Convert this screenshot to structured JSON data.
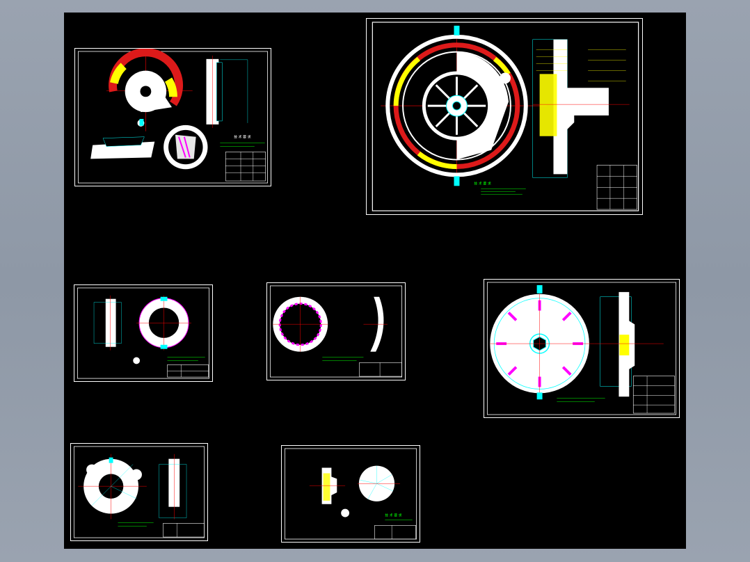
{
  "viewer": {
    "background_color": "#9aa3b0",
    "canvas_color": "#000000",
    "line_colors": {
      "outline": "#ffffff",
      "center": "#ff0000",
      "dimension": "#00ffff",
      "hatch_red": "#dd1a1a",
      "hatch_yellow": "#ffff00",
      "spring": "#ff66ff",
      "note": "#00ff00"
    }
  },
  "sheets": [
    {
      "id": "sheet-1",
      "content": "clutch assembly sectional view with spring and lever details"
    },
    {
      "id": "sheet-2",
      "content": "clutch general assembly drawing with section view"
    },
    {
      "id": "sheet-3",
      "content": "friction disc part drawing"
    },
    {
      "id": "sheet-4",
      "content": "diaphragm spring part drawing"
    },
    {
      "id": "sheet-5",
      "content": "driven plate with torsional damper springs"
    },
    {
      "id": "sheet-6",
      "content": "pressure plate part drawing"
    },
    {
      "id": "sheet-7",
      "content": "hub and small parts drawing"
    }
  ]
}
